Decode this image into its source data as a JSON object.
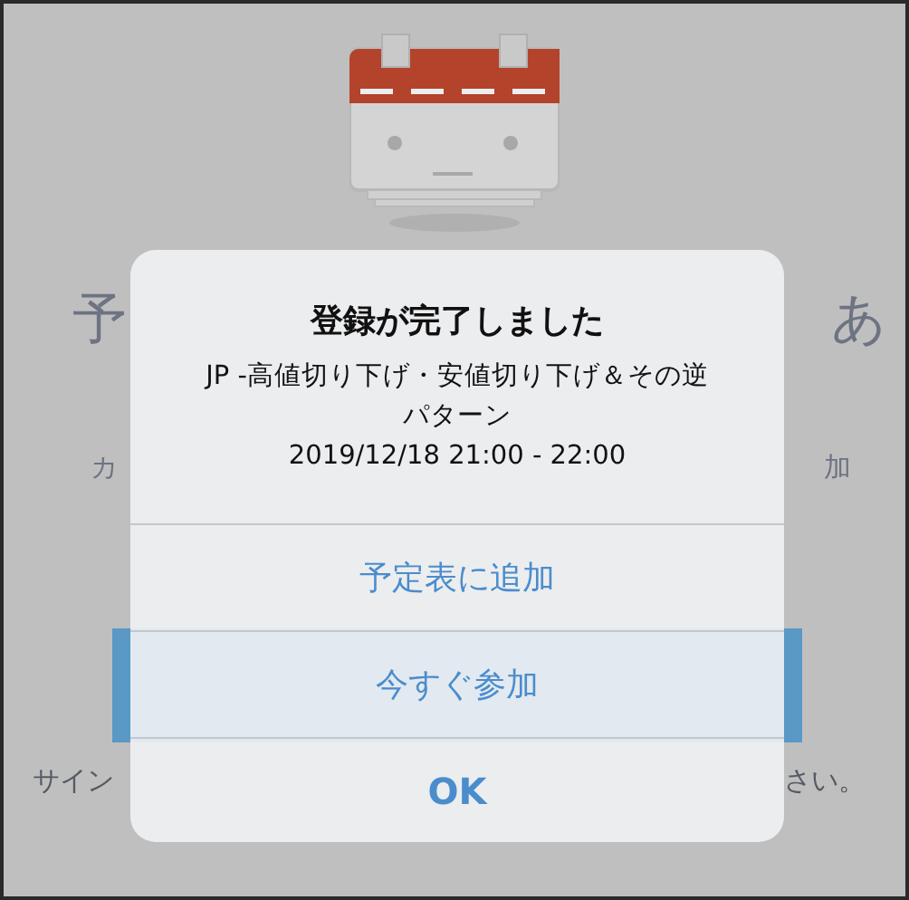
{
  "background": {
    "heading_left": "予",
    "heading_right": "あ",
    "description_left": "カ",
    "description_right": "加",
    "note_left": "サイン",
    "note_right": "さい。"
  },
  "dialog": {
    "title": "登録が完了しました",
    "message_lines": [
      "JP -高値切り下げ・安値切り下げ＆その逆",
      "パターン",
      "2019/12/18 21:00 - 22:00"
    ],
    "buttons": [
      {
        "label": "予定表に追加",
        "kind": "default"
      },
      {
        "label": "今すぐ参加",
        "kind": "default"
      },
      {
        "label": "OK",
        "kind": "bold"
      }
    ]
  }
}
